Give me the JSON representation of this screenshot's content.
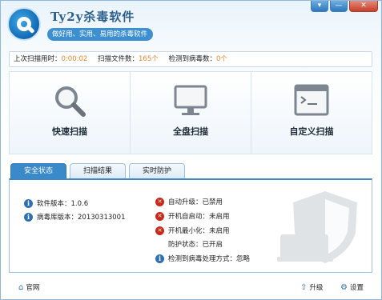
{
  "window": {
    "title": "Ty2y杀毒软件",
    "slogan": "做好用、实用、易用的杀毒软件",
    "buttons": [
      "▾",
      "—",
      "✕"
    ]
  },
  "infobar": {
    "scan_time_label": "上次扫描用时：",
    "scan_time_value": "0:00:02",
    "files_label": "扫描文件数：",
    "files_value": "165个",
    "virus_label": "检测到病毒数：",
    "virus_value": "0个"
  },
  "scan_buttons": [
    {
      "label": "快速扫描",
      "icon": "magnifier-icon"
    },
    {
      "label": "全盘扫描",
      "icon": "monitor-icon"
    },
    {
      "label": "自定义扫描",
      "icon": "terminal-icon"
    }
  ],
  "tabs": [
    {
      "label": "安全状态",
      "active": true
    },
    {
      "label": "扫描结果",
      "active": false
    },
    {
      "label": "实时防护",
      "active": false
    }
  ],
  "status_left": [
    {
      "icon": "info",
      "text": "软件版本：1.0.6"
    },
    {
      "icon": "info",
      "text": "病毒库版本：20130313001"
    }
  ],
  "status_right": [
    {
      "icon": "error",
      "text": "自动升级：已禁用"
    },
    {
      "icon": "error",
      "text": "开机自启动：未启用"
    },
    {
      "icon": "error",
      "text": "开机最小化：未启用"
    },
    {
      "icon": "none",
      "text": "防护状态：已开启"
    },
    {
      "icon": "info",
      "text": "检测到病毒处理方式：忽略"
    }
  ],
  "footer": {
    "homepage": "官网",
    "upgrade": "升级",
    "settings": "设置"
  },
  "colors": {
    "accent": "#3a89c9",
    "value_orange": "#e8862c",
    "error_red": "#c9281b",
    "info_blue": "#2f6fb2"
  }
}
